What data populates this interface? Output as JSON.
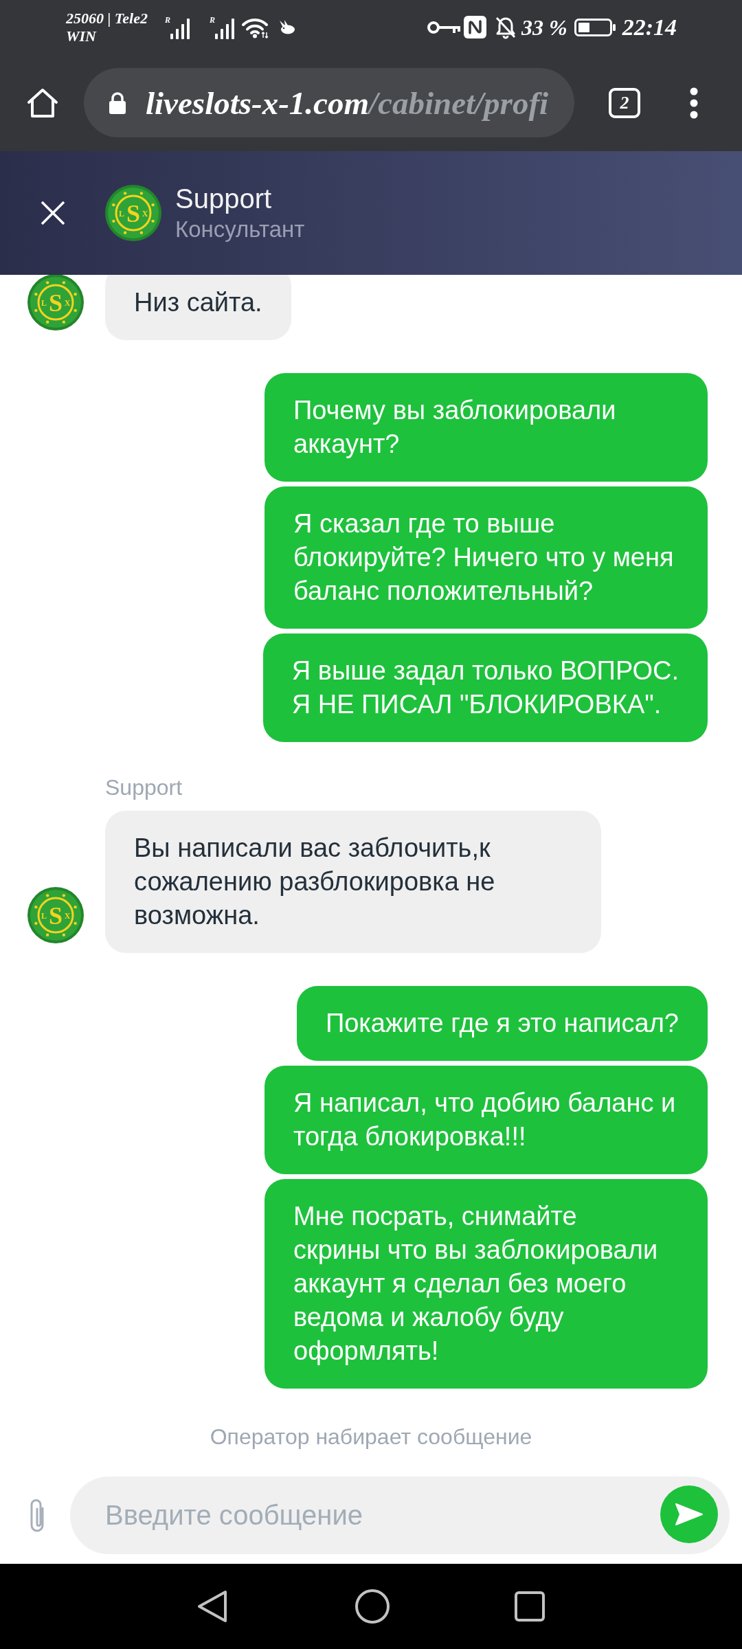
{
  "status_bar": {
    "carrier": [
      "25060 | Tele2",
      "WIN"
    ],
    "signals": [
      {
        "badge": "R"
      },
      {
        "badge": "R"
      }
    ],
    "battery": "33 %",
    "time": "22:14"
  },
  "browser_toolbar": {
    "url_host": "liveslots-x-1.com",
    "url_path": "/cabinet/profi",
    "tab_count": "2"
  },
  "chat_header": {
    "title": "Support",
    "subtitle": "Консультант",
    "avatar": {
      "letters": [
        "L",
        "S",
        "X"
      ]
    }
  },
  "messages": [
    {
      "kind": "incoming",
      "lines": [
        "Низ сайта."
      ],
      "avatar": {
        "letters": [
          "L",
          "S",
          "X"
        ]
      }
    },
    {
      "kind": "outgoing",
      "lines": [
        "Почему вы заблокировали",
        "аккаунт?"
      ]
    },
    {
      "kind": "outgoing",
      "lines": [
        "Я сказал где то выше",
        "блокируйте? Ничего что у меня",
        "баланс положительный?"
      ]
    },
    {
      "kind": "outgoing",
      "lines": [
        "Я выше задал только ВОПРОС.",
        "Я НЕ ПИСАЛ \"БЛОКИРОВКА\"."
      ]
    },
    {
      "kind": "incoming",
      "sender": "Support",
      "lines": [
        "Вы написали вас заблочить,к",
        "сожалению разблокировка не",
        "возможна."
      ],
      "avatar": {
        "letters": [
          "L",
          "S",
          "X"
        ]
      }
    },
    {
      "kind": "outgoing",
      "lines": [
        "Покажите где я это написал?"
      ]
    },
    {
      "kind": "outgoing",
      "lines": [
        "Я написал, что добию баланс и",
        "тогда блокировка!!!"
      ]
    },
    {
      "kind": "outgoing",
      "lines": [
        "Мне посрать, снимайте",
        "скрины что вы заблокировали",
        "аккаунт я сделал без моего",
        "ведома и жалобу буду",
        "оформлять!"
      ]
    }
  ],
  "typing_indicator": "Оператор набирает сообщение",
  "composer": {
    "placeholder": "Введите сообщение"
  }
}
